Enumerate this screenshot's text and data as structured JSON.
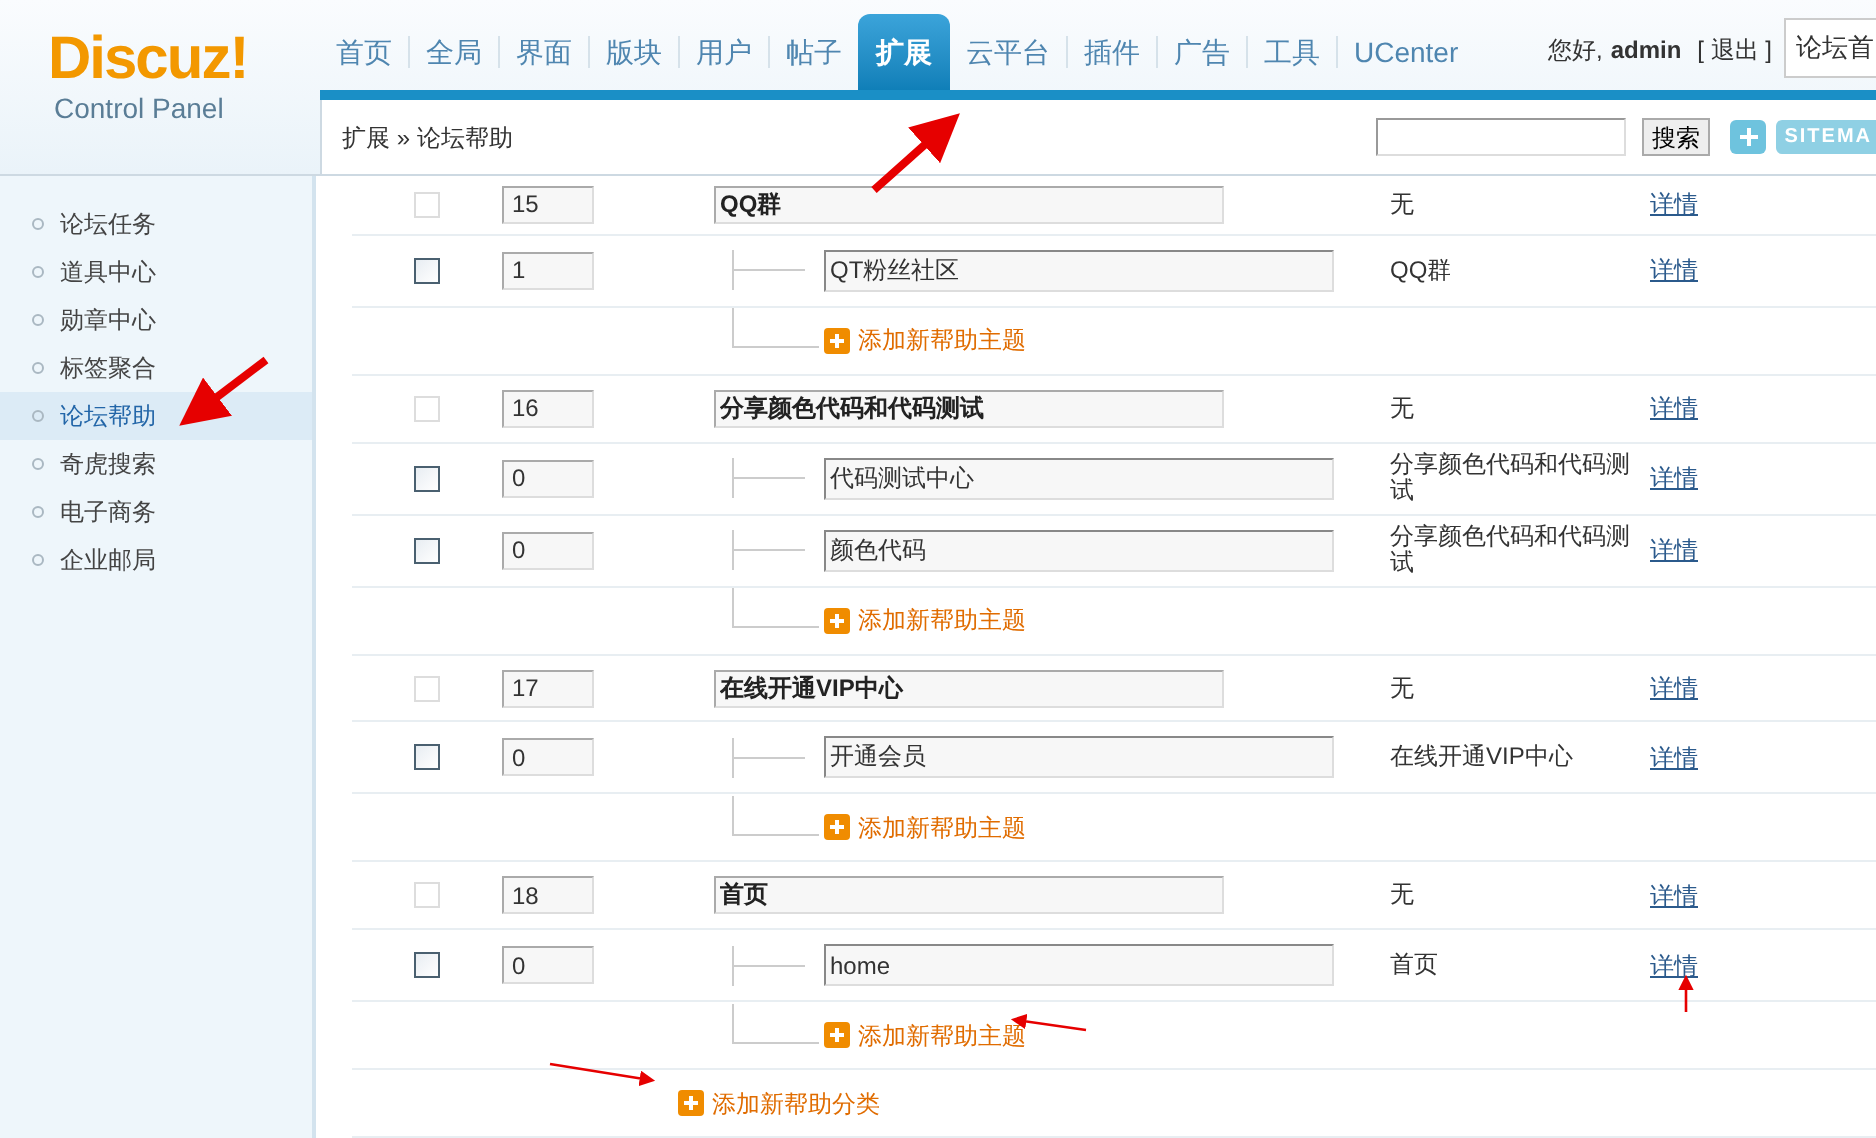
{
  "logo": {
    "brand": "Discuz!",
    "subtitle": "Control Panel"
  },
  "nav": [
    {
      "label": "首页",
      "selected": false
    },
    {
      "label": "全局",
      "selected": false
    },
    {
      "label": "界面",
      "selected": false
    },
    {
      "label": "版块",
      "selected": false
    },
    {
      "label": "用户",
      "selected": false
    },
    {
      "label": "帖子",
      "selected": false
    },
    {
      "label": "扩展",
      "selected": true
    },
    {
      "label": "云平台",
      "selected": false
    },
    {
      "label": "插件",
      "selected": false
    },
    {
      "label": "广告",
      "selected": false
    },
    {
      "label": "工具",
      "selected": false
    },
    {
      "label": "UCenter",
      "selected": false
    }
  ],
  "user": {
    "greeting": "您好,",
    "name": "admin",
    "logout": "[ 退出 ]"
  },
  "quick_select": "论坛首",
  "toolbar": {
    "breadcrumb": "扩展 » 论坛帮助",
    "search_button": "搜索",
    "sitemap": "SITEMA"
  },
  "sidebar": [
    {
      "label": "论坛任务",
      "selected": false
    },
    {
      "label": "道具中心",
      "selected": false
    },
    {
      "label": "勋章中心",
      "selected": false
    },
    {
      "label": "标签聚合",
      "selected": false
    },
    {
      "label": "论坛帮助",
      "selected": true
    },
    {
      "label": "奇虎搜索",
      "selected": false
    },
    {
      "label": "电子商务",
      "selected": false
    },
    {
      "label": "企业邮局",
      "selected": false
    }
  ],
  "rows": [
    {
      "kind": "category",
      "checked": false,
      "disabled": true,
      "order": "15",
      "name": "QQ群",
      "parent": "无",
      "link": "详情"
    },
    {
      "kind": "topic",
      "checked": false,
      "disabled": false,
      "order": "1",
      "name": "QT粉丝社区",
      "parent": "QQ群",
      "link": "详情"
    },
    {
      "kind": "add_topic",
      "label": "添加新帮助主题"
    },
    {
      "kind": "category",
      "checked": false,
      "disabled": true,
      "order": "16",
      "name": "分享颜色代码和代码测试",
      "parent": "无",
      "link": "详情"
    },
    {
      "kind": "topic",
      "checked": false,
      "disabled": false,
      "order": "0",
      "name": "代码测试中心",
      "parent": "分享颜色代码和代码测试",
      "link": "详情"
    },
    {
      "kind": "topic",
      "checked": false,
      "disabled": false,
      "order": "0",
      "name": "颜色代码",
      "parent": "分享颜色代码和代码测试",
      "link": "详情"
    },
    {
      "kind": "add_topic",
      "label": "添加新帮助主题"
    },
    {
      "kind": "category",
      "checked": false,
      "disabled": true,
      "order": "17",
      "name": "在线开通VIP中心",
      "parent": "无",
      "link": "详情"
    },
    {
      "kind": "topic",
      "checked": false,
      "disabled": false,
      "order": "0",
      "name": "开通会员",
      "parent": "在线开通VIP中心",
      "link": "详情"
    },
    {
      "kind": "add_topic",
      "label": "添加新帮助主题"
    },
    {
      "kind": "category",
      "checked": false,
      "disabled": true,
      "order": "18",
      "name": "首页",
      "parent": "无",
      "link": "详情"
    },
    {
      "kind": "topic",
      "checked": false,
      "disabled": false,
      "order": "0",
      "name": "home",
      "parent": "首页",
      "link": "详情"
    },
    {
      "kind": "add_topic",
      "label": "添加新帮助主题"
    }
  ],
  "add_category": "添加新帮助分类"
}
